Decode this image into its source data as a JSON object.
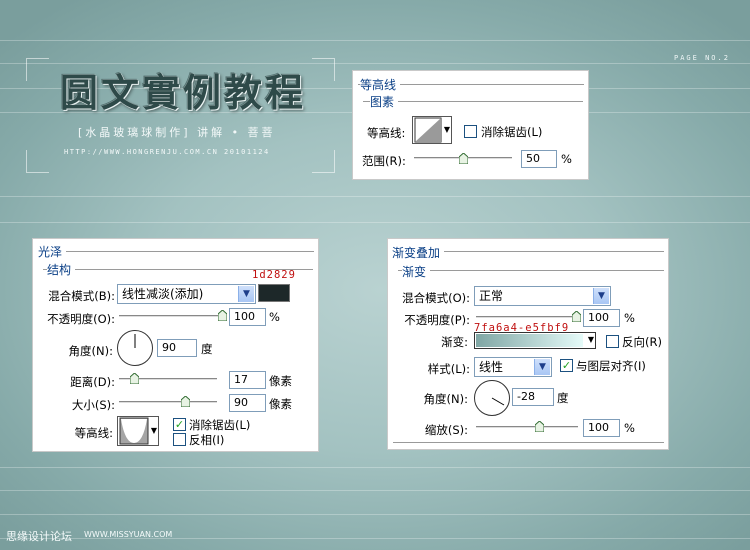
{
  "page_label": "PAGE NO.2",
  "brand": {
    "title": "圆文實例教程",
    "subtitle": "[水晶玻璃球制作] 讲解 • 菩菩",
    "url_line": "HTTP://WWW.HONGRENJU.COM.CN  20101124"
  },
  "contour_panel": {
    "title": "等高线",
    "section": "图素",
    "contour_label": "等高线:",
    "anti_alias_label": "消除锯齿(L)",
    "anti_alias_checked": false,
    "range_label": "范围(R):",
    "range_value": "50",
    "range_unit": "%",
    "range_fraction": 0.5
  },
  "satin_panel": {
    "title": "光泽",
    "section": "结构",
    "color_note": "1d2829",
    "color_hex": "#1d2829",
    "blend_label": "混合模式(B):",
    "blend_value": "线性减淡(添加)",
    "opacity_label": "不透明度(O):",
    "opacity_value": "100",
    "opacity_unit": "%",
    "opacity_fraction": 1.0,
    "angle_label": "角度(N):",
    "angle_value": "90",
    "angle_unit": "度",
    "distance_label": "距离(D):",
    "distance_value": "17",
    "distance_unit": "像素",
    "distance_fraction": 0.12,
    "size_label": "大小(S):",
    "size_value": "90",
    "size_unit": "像素",
    "size_fraction": 0.36,
    "contour_label": "等高线:",
    "anti_alias_label": "消除锯齿(L)",
    "anti_alias_checked": true,
    "invert_label": "反相(I)",
    "invert_checked": false
  },
  "gradient_panel": {
    "title": "渐变叠加",
    "section": "渐变",
    "blend_label": "混合模式(O):",
    "blend_value": "正常",
    "opacity_label": "不透明度(P):",
    "opacity_value": "100",
    "opacity_unit": "%",
    "opacity_fraction": 1.0,
    "gradient_note": "7fa6a4-e5fbf9",
    "gradient_from": "#7fa6a4",
    "gradient_to": "#e5fbf9",
    "gradient_label": "渐变:",
    "reverse_label": "反向(R)",
    "reverse_checked": false,
    "style_label": "样式(L):",
    "style_value": "线性",
    "align_label": "与图层对齐(I)",
    "align_checked": true,
    "angle_label": "角度(N):",
    "angle_value": "-28",
    "angle_unit": "度",
    "scale_label": "缩放(S):",
    "scale_value": "100",
    "scale_unit": "%",
    "scale_fraction": 0.6
  },
  "footer": {
    "site_cn": "思缘设计论坛",
    "site_url": "WWW.MISSYUAN.COM"
  }
}
